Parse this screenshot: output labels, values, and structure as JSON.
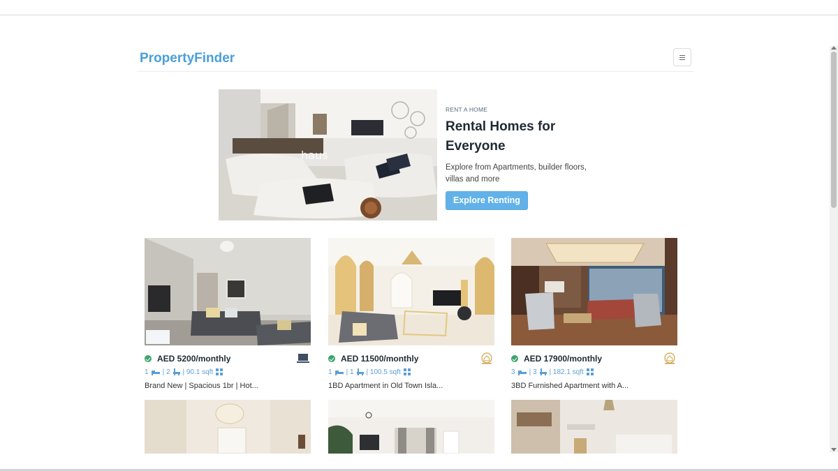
{
  "brand": "PropertyFinder",
  "hero": {
    "eyebrow": "RENT A HOME",
    "title": "Rental Homes for Everyone",
    "description": "Explore from Apartments, builder floors, villas and more",
    "cta_label": "Explore Renting",
    "image_watermark": "haus"
  },
  "listings": [
    {
      "price": "AED 5200/monthly",
      "beds": "1",
      "baths": "| 2",
      "area": "| 90.1 sqft",
      "title": "Brand New | Spacious 1br | Hot..."
    },
    {
      "price": "AED 11500/monthly",
      "beds": "1",
      "baths": "| 1",
      "area": "| 100.5 sqft",
      "title": "1BD Apartment in Old Town Isla..."
    },
    {
      "price": "AED 17900/monthly",
      "beds": "3",
      "baths": "| 3",
      "area": "| 182.1 sqft",
      "title": "3BD Furnished Apartment with A..."
    }
  ],
  "colors": {
    "brand": "#4a9fd8",
    "cta": "#62b2e9",
    "verified": "#3ca36a",
    "meta": "#5a9fd6"
  },
  "icons": [
    "hamburger-icon",
    "verified-check-icon",
    "bed-icon",
    "bath-icon",
    "grid-icon",
    "agency-logo-icon"
  ]
}
